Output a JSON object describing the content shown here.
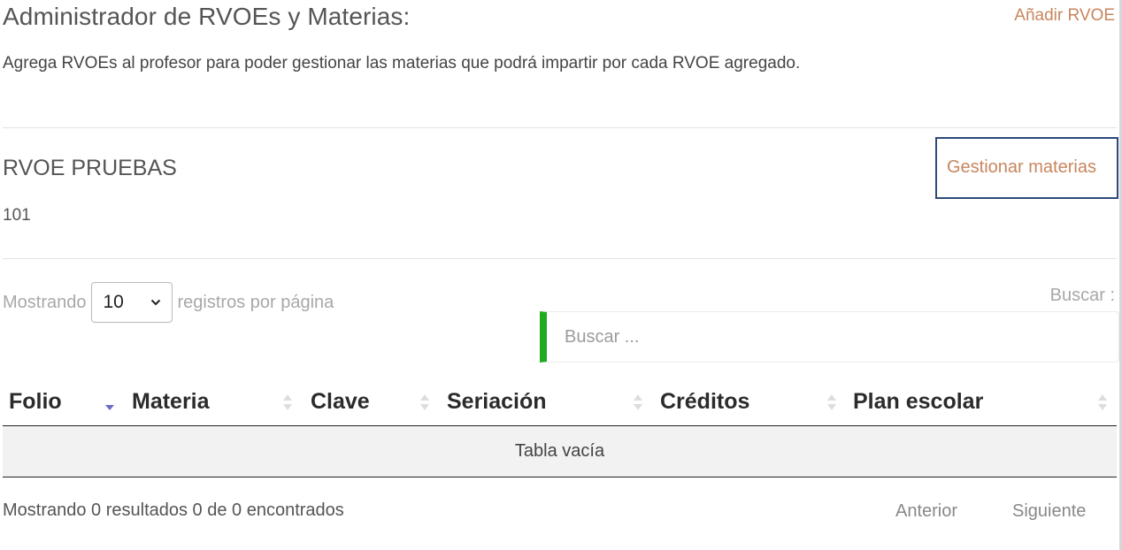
{
  "header": {
    "title": "Administrador de RVOEs y Materias:",
    "add_link": "Añadir RVOE",
    "description": "Agrega RVOEs al profesor para poder gestionar las materias que podrá impartir por cada RVOE agregado."
  },
  "rvoe": {
    "name": "RVOE PRUEBAS",
    "code": "101",
    "manage_link": "Gestionar materias"
  },
  "table_controls": {
    "showing_prefix": "Mostrando",
    "page_size": "10",
    "showing_suffix": "registros por página",
    "search_label": "Buscar :",
    "search_placeholder": "Buscar ..."
  },
  "table": {
    "columns": [
      "Folio",
      "Materia",
      "Clave",
      "Seriación",
      "Créditos",
      "Plan escolar"
    ],
    "sorted_column": "Folio",
    "sorted_direction": "descending",
    "empty_message": "Tabla vacía"
  },
  "footer": {
    "info": "Mostrando 0 resultados 0 de 0 encontrados",
    "prev": "Anterior",
    "next": "Siguiente"
  },
  "colors": {
    "link": "#c8865e",
    "highlight_border": "#2d4a7a",
    "search_accent": "#1faa1f",
    "sort_active": "#6c6cc8"
  }
}
